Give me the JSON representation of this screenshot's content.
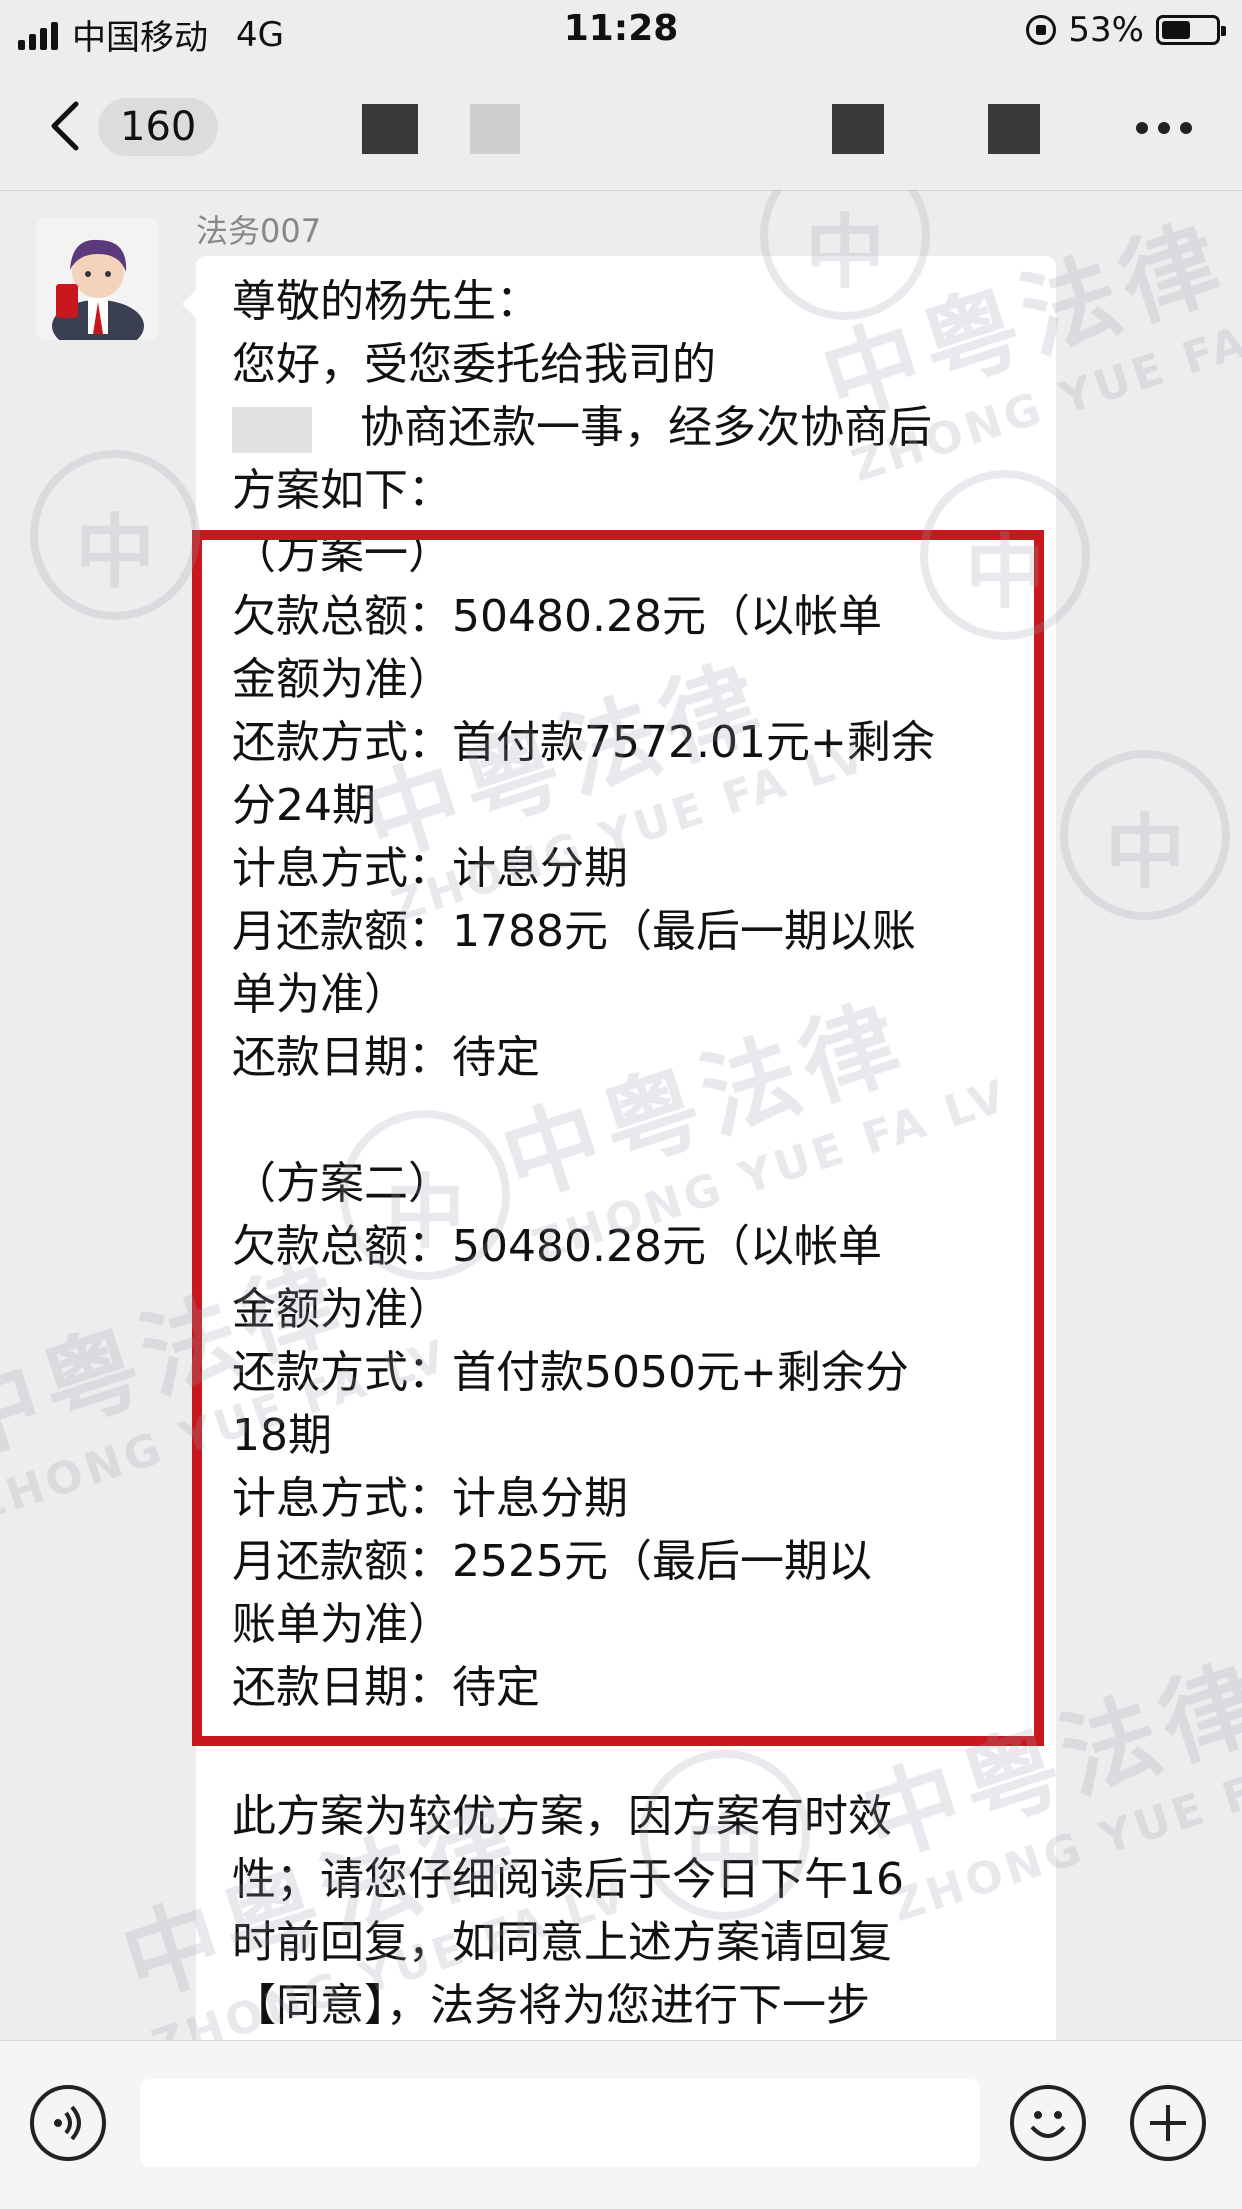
{
  "status_bar": {
    "carrier": "中国移动",
    "network": "4G",
    "time": "11:28",
    "battery_percent": "53%",
    "battery_level": 0.53
  },
  "nav": {
    "back_count": "160"
  },
  "message": {
    "sender": "法务007",
    "lines": [
      "尊敬的杨先生：",
      "您好，受您委托给我司的",
      "协商还款一事，经多次协商后",
      "方案如下：",
      "（方案一）",
      "欠款总额：50480.28元（以帐单",
      "金额为准）",
      "还款方式：首付款7572.01元+剩余",
      "分24期",
      "计息方式：计息分期",
      "月还款额：1788元（最后一期以账",
      "单为准）",
      "还款日期：待定",
      "",
      "（方案二）",
      "欠款总额：50480.28元（以帐单",
      "金额为准）",
      "还款方式：首付款5050元+剩余分",
      "18期",
      "计息方式：计息分期",
      "月还款额：2525元（最后一期以",
      "账单为准）",
      "还款日期：待定",
      "",
      "此方案为较优方案，因方案有时效",
      "性；请您仔细阅读后于今日下午16",
      "时前回复，如同意上述方案请回复",
      "【同意】，法务将为您进行下一步"
    ]
  },
  "watermark": {
    "cn": "中粤法律",
    "en": "ZHONG YUE FA LV"
  },
  "colors": {
    "highlight_border": "#c8181d",
    "bubble": "#ffffff",
    "background": "#ededed"
  },
  "icons": {
    "voice": "voice-icon",
    "emoji": "emoji-icon",
    "plus": "plus-icon",
    "back": "chevron-left-icon",
    "more": "more-icon"
  }
}
